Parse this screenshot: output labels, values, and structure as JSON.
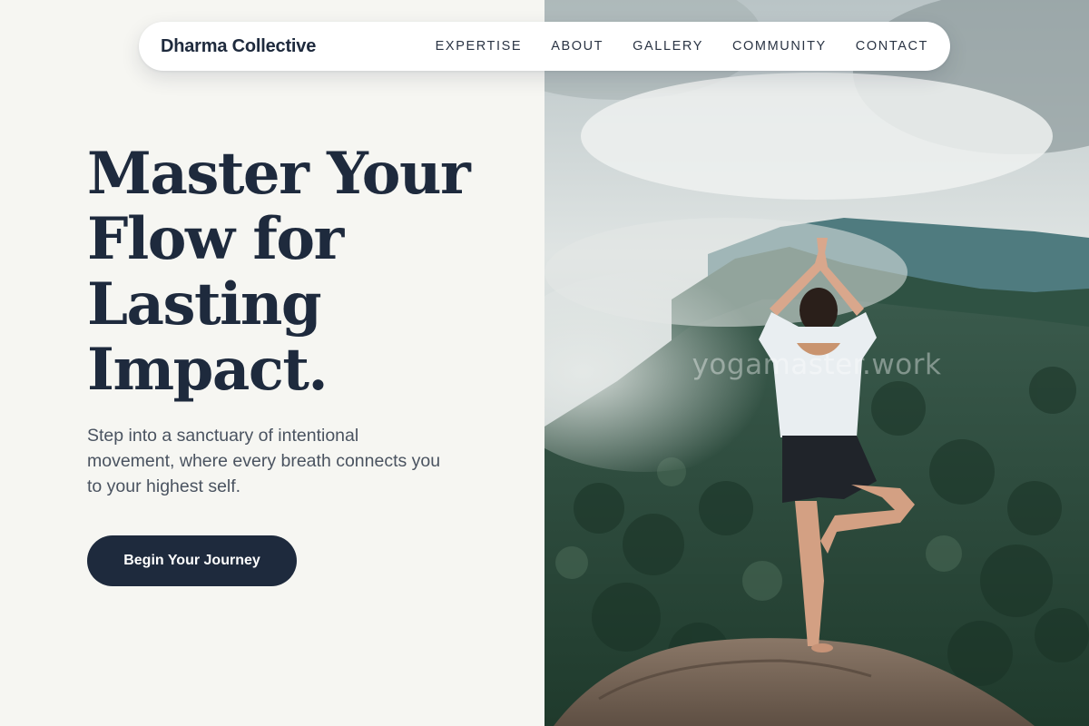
{
  "brand": {
    "name": "Dharma Collective"
  },
  "nav": {
    "items": [
      {
        "label": "EXPERTISE"
      },
      {
        "label": "ABOUT"
      },
      {
        "label": "GALLERY"
      },
      {
        "label": "COMMUNITY"
      },
      {
        "label": "CONTACT"
      }
    ]
  },
  "hero": {
    "headline_lines": [
      "Master Your",
      "Flow for",
      "Lasting",
      "Impact."
    ],
    "subtext": "Step into a sanctuary of intentional movement, where every breath connects you to your highest self.",
    "cta_label": "Begin Your Journey"
  },
  "photo": {
    "subject": "woman in tree pose on a rock above misty mountains",
    "watermark": "yogamaster.work"
  },
  "colors": {
    "page_background": "#f6f6f2",
    "navy": "#1e2a3d",
    "body_text": "#4a5360",
    "nav_background": "#ffffff"
  }
}
